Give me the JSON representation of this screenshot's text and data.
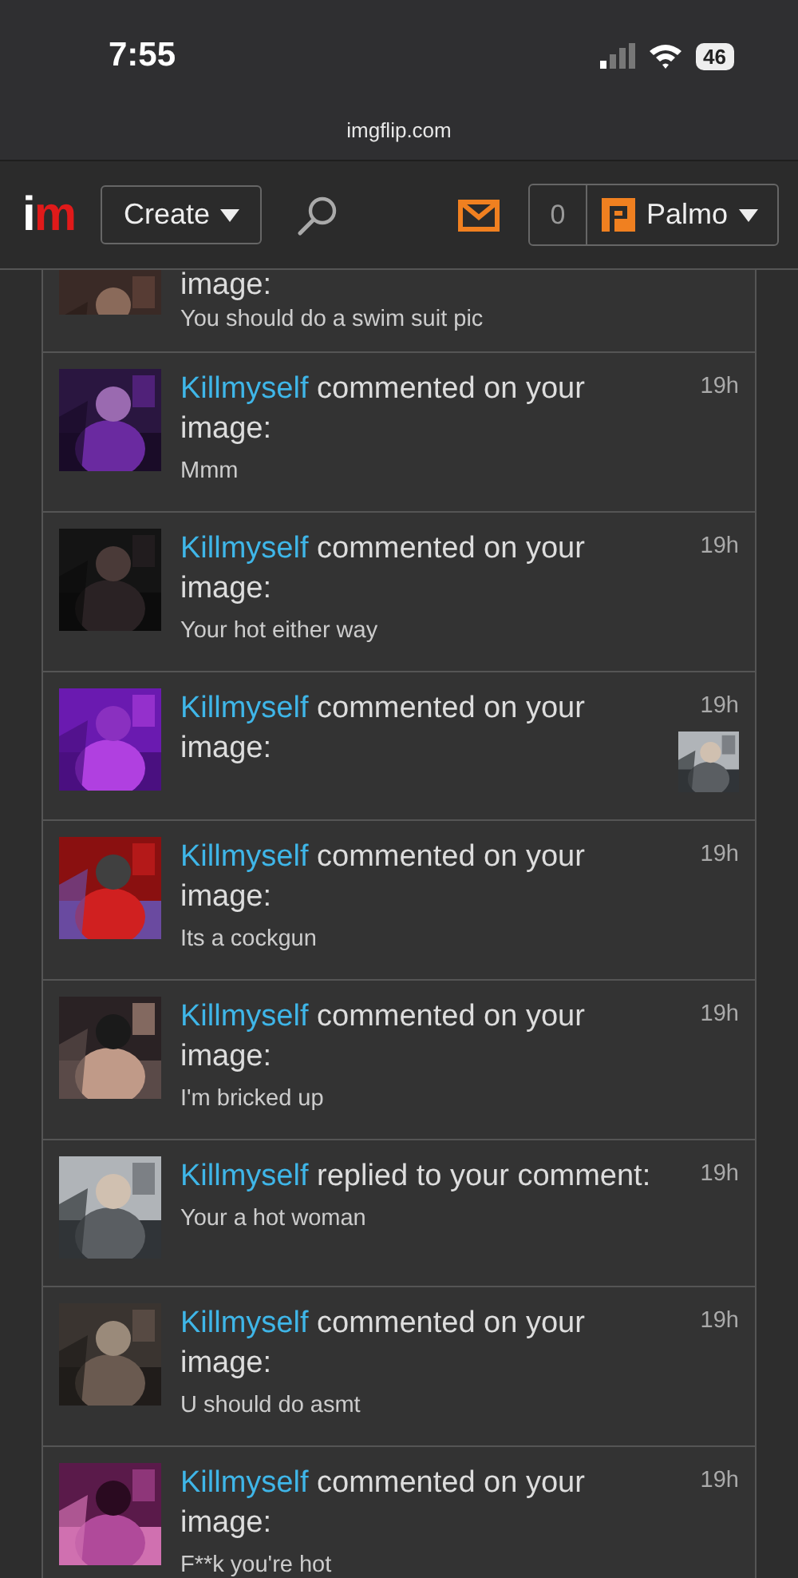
{
  "status_bar": {
    "time": "7:55",
    "battery": "46"
  },
  "address_bar": {
    "url": "imgflip.com"
  },
  "nav": {
    "logo_i": "i",
    "logo_m": "m",
    "create_label": "Create",
    "points": "0",
    "username": "Palmo"
  },
  "notifications": [
    {
      "action": "image:",
      "comment": "You should do a swim suit pic"
    },
    {
      "user": "Killmyself",
      "action": "commented on your image:",
      "comment": "Mmm",
      "time": "19h"
    },
    {
      "user": "Killmyself",
      "action": "commented on your image:",
      "comment": "Your hot either way",
      "time": "19h"
    },
    {
      "user": "Killmyself",
      "action": "commented on your image:",
      "time": "19h"
    },
    {
      "user": "Killmyself",
      "action": "commented on your image:",
      "comment": "Its a cockgun",
      "time": "19h"
    },
    {
      "user": "Killmyself",
      "action": "commented on your image:",
      "comment": "I'm bricked up",
      "time": "19h"
    },
    {
      "user": "Killmyself",
      "action": "replied to your comment:",
      "comment": "Your a hot woman",
      "time": "19h"
    },
    {
      "user": "Killmyself",
      "action": "commented on your image:",
      "comment": "U should do asmt",
      "time": "19h"
    },
    {
      "user": "Killmyself",
      "action": "commented on your image:",
      "comment": "F**k you're hot",
      "time": "19h"
    }
  ]
}
